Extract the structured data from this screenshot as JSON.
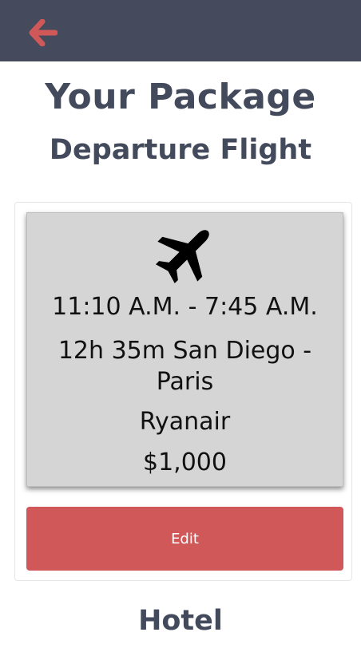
{
  "header": {
    "back_icon": "arrow-left-icon",
    "accent_color": "#d05858",
    "background_color": "#454b5c"
  },
  "page": {
    "title": "Your Package",
    "section_title": "Departure Flight",
    "next_section_title": "Hotel"
  },
  "flight": {
    "icon": "plane-icon",
    "time": "11:10 A.M. - 7:45 A.M.",
    "route": "12h 35m San Diego - Paris",
    "airline": "Ryanair",
    "price": "$1,000"
  },
  "actions": {
    "edit_label": "Edit"
  }
}
